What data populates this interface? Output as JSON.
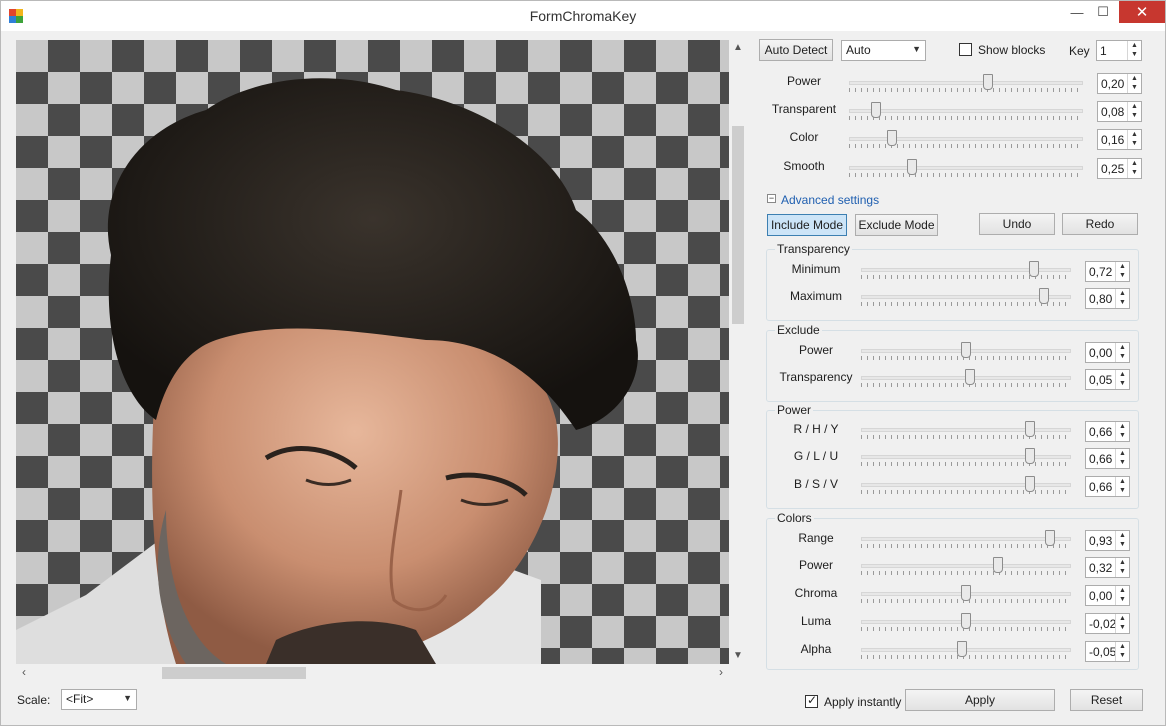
{
  "window": {
    "title": "FormChromaKey"
  },
  "top": {
    "auto_detect_label": "Auto Detect",
    "mode_select": "Auto",
    "show_blocks_label": "Show blocks",
    "show_blocks_checked": false,
    "key_label": "Key",
    "key_value": "1"
  },
  "main_sliders": [
    {
      "label": "Power",
      "value": "0,20",
      "level": 0.6
    },
    {
      "label": "Transparent",
      "value": "0,08",
      "level": 0.1
    },
    {
      "label": "Color",
      "value": "0,16",
      "level": 0.17
    },
    {
      "label": "Smooth",
      "value": "0,25",
      "level": 0.26
    }
  ],
  "advanced": {
    "toggle": "−",
    "label": "Advanced settings",
    "include_mode": "Include Mode",
    "exclude_mode": "Exclude Mode",
    "undo": "Undo",
    "redo": "Redo",
    "groups": [
      {
        "title": "Transparency",
        "rows": [
          {
            "label": "Minimum",
            "value": "0,72",
            "level": 0.84
          },
          {
            "label": "Maximum",
            "value": "0,80",
            "level": 0.89
          }
        ]
      },
      {
        "title": "Exclude",
        "rows": [
          {
            "label": "Power",
            "value": "0,00",
            "level": 0.5
          },
          {
            "label": "Transparency",
            "value": "0,05",
            "level": 0.52
          }
        ]
      },
      {
        "title": "Power",
        "rows": [
          {
            "label": "R / H / Y",
            "value": "0,66",
            "level": 0.82
          },
          {
            "label": "G / L / U",
            "value": "0,66",
            "level": 0.82
          },
          {
            "label": "B / S / V",
            "value": "0,66",
            "level": 0.82
          }
        ]
      },
      {
        "title": "Colors",
        "rows": [
          {
            "label": "Range",
            "value": "0,93",
            "level": 0.92
          },
          {
            "label": "Power",
            "value": "0,32",
            "level": 0.66
          },
          {
            "label": "Chroma",
            "value": "0,00",
            "level": 0.5
          },
          {
            "label": "Luma",
            "value": "-0,02",
            "level": 0.5
          },
          {
            "label": "Alpha",
            "value": "-0,05",
            "level": 0.48
          }
        ]
      }
    ]
  },
  "bottom": {
    "scale_label": "Scale:",
    "scale_value": "<Fit>",
    "apply_instantly_label": "Apply instantly",
    "apply_instantly_checked": true,
    "apply_label": "Apply",
    "reset_label": "Reset"
  },
  "icons": {
    "app": "app-icon",
    "minimize": "minimize-icon",
    "maximize": "maximize-icon",
    "close": "close-icon"
  }
}
